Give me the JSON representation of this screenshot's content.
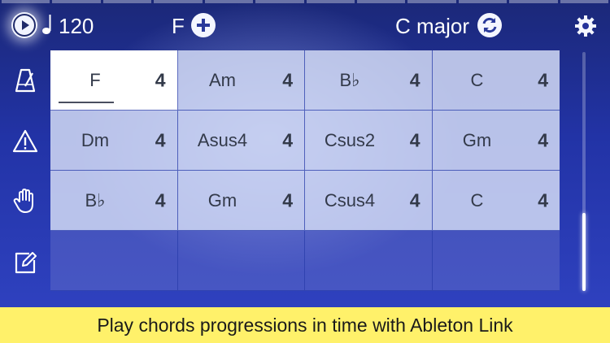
{
  "header": {
    "tempo": "120",
    "chord_key": "F",
    "scale": "C major"
  },
  "grid": {
    "rows": [
      [
        {
          "name": "F",
          "beats": "4",
          "selected": true
        },
        {
          "name": "Am",
          "beats": "4"
        },
        {
          "name": "B♭",
          "beats": "4"
        },
        {
          "name": "C",
          "beats": "4"
        }
      ],
      [
        {
          "name": "Dm",
          "beats": "4"
        },
        {
          "name": "Asus4",
          "beats": "4"
        },
        {
          "name": "Csus2",
          "beats": "4"
        },
        {
          "name": "Gm",
          "beats": "4"
        }
      ],
      [
        {
          "name": "B♭",
          "beats": "4"
        },
        {
          "name": "Gm",
          "beats": "4"
        },
        {
          "name": "Csus4",
          "beats": "4"
        },
        {
          "name": "C",
          "beats": "4"
        }
      ]
    ]
  },
  "icons": {
    "play": "play-icon",
    "tempo": "music-note-icon",
    "add": "plus-icon",
    "refresh": "refresh-icon",
    "settings": "gear-icon",
    "side": [
      "metronome-icon",
      "warning-icon",
      "hand-icon",
      "edit-icon"
    ]
  },
  "banner": {
    "text": "Play chords progressions in time with Ableton Link"
  },
  "colors": {
    "banner_bg": "#fff16a",
    "selected_cell": "#ffffff",
    "cell_bg": "#d2daf5",
    "grid_line": "#283caa"
  }
}
